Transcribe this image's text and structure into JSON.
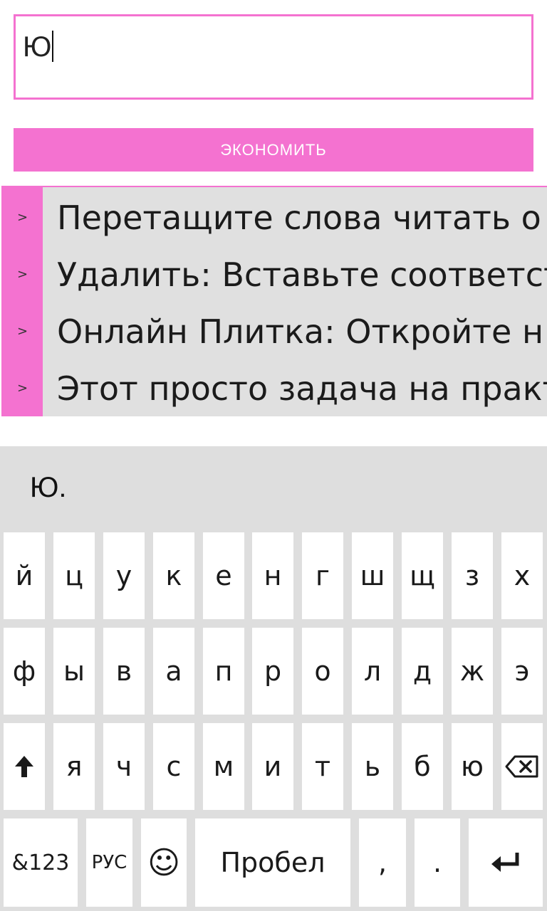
{
  "input": {
    "value": "Ю"
  },
  "save_button": {
    "label": "ЭКОНОМИТЬ"
  },
  "list": {
    "items": [
      {
        "chevron": ">",
        "text": "Перетащите слова читать о"
      },
      {
        "chevron": ">",
        "text": "Удалить: Вставьте соответств"
      },
      {
        "chevron": ">",
        "text": "Онлайн Плитка: Откройте н"
      },
      {
        "chevron": ">",
        "text": "Этот просто задача на практ"
      }
    ]
  },
  "keyboard": {
    "suggestion": "Ю.",
    "row1": [
      "й",
      "ц",
      "у",
      "к",
      "е",
      "н",
      "г",
      "ш",
      "щ",
      "з",
      "х"
    ],
    "row2": [
      "ф",
      "ы",
      "в",
      "а",
      "п",
      "р",
      "о",
      "л",
      "д",
      "ж",
      "э"
    ],
    "row3": [
      "shift-icon",
      "я",
      "ч",
      "с",
      "м",
      "и",
      "т",
      "ь",
      "б",
      "ю",
      "backspace-icon"
    ],
    "row4": {
      "numbers": "&123",
      "language": "РУС",
      "emoji": "☺",
      "space": "Пробел",
      "comma": ",",
      "period": ".",
      "enter": "enter-icon"
    }
  },
  "colors": {
    "accent": "#f472d0",
    "panel": "#e0e0e0",
    "keyboard_bg": "#dedede"
  }
}
